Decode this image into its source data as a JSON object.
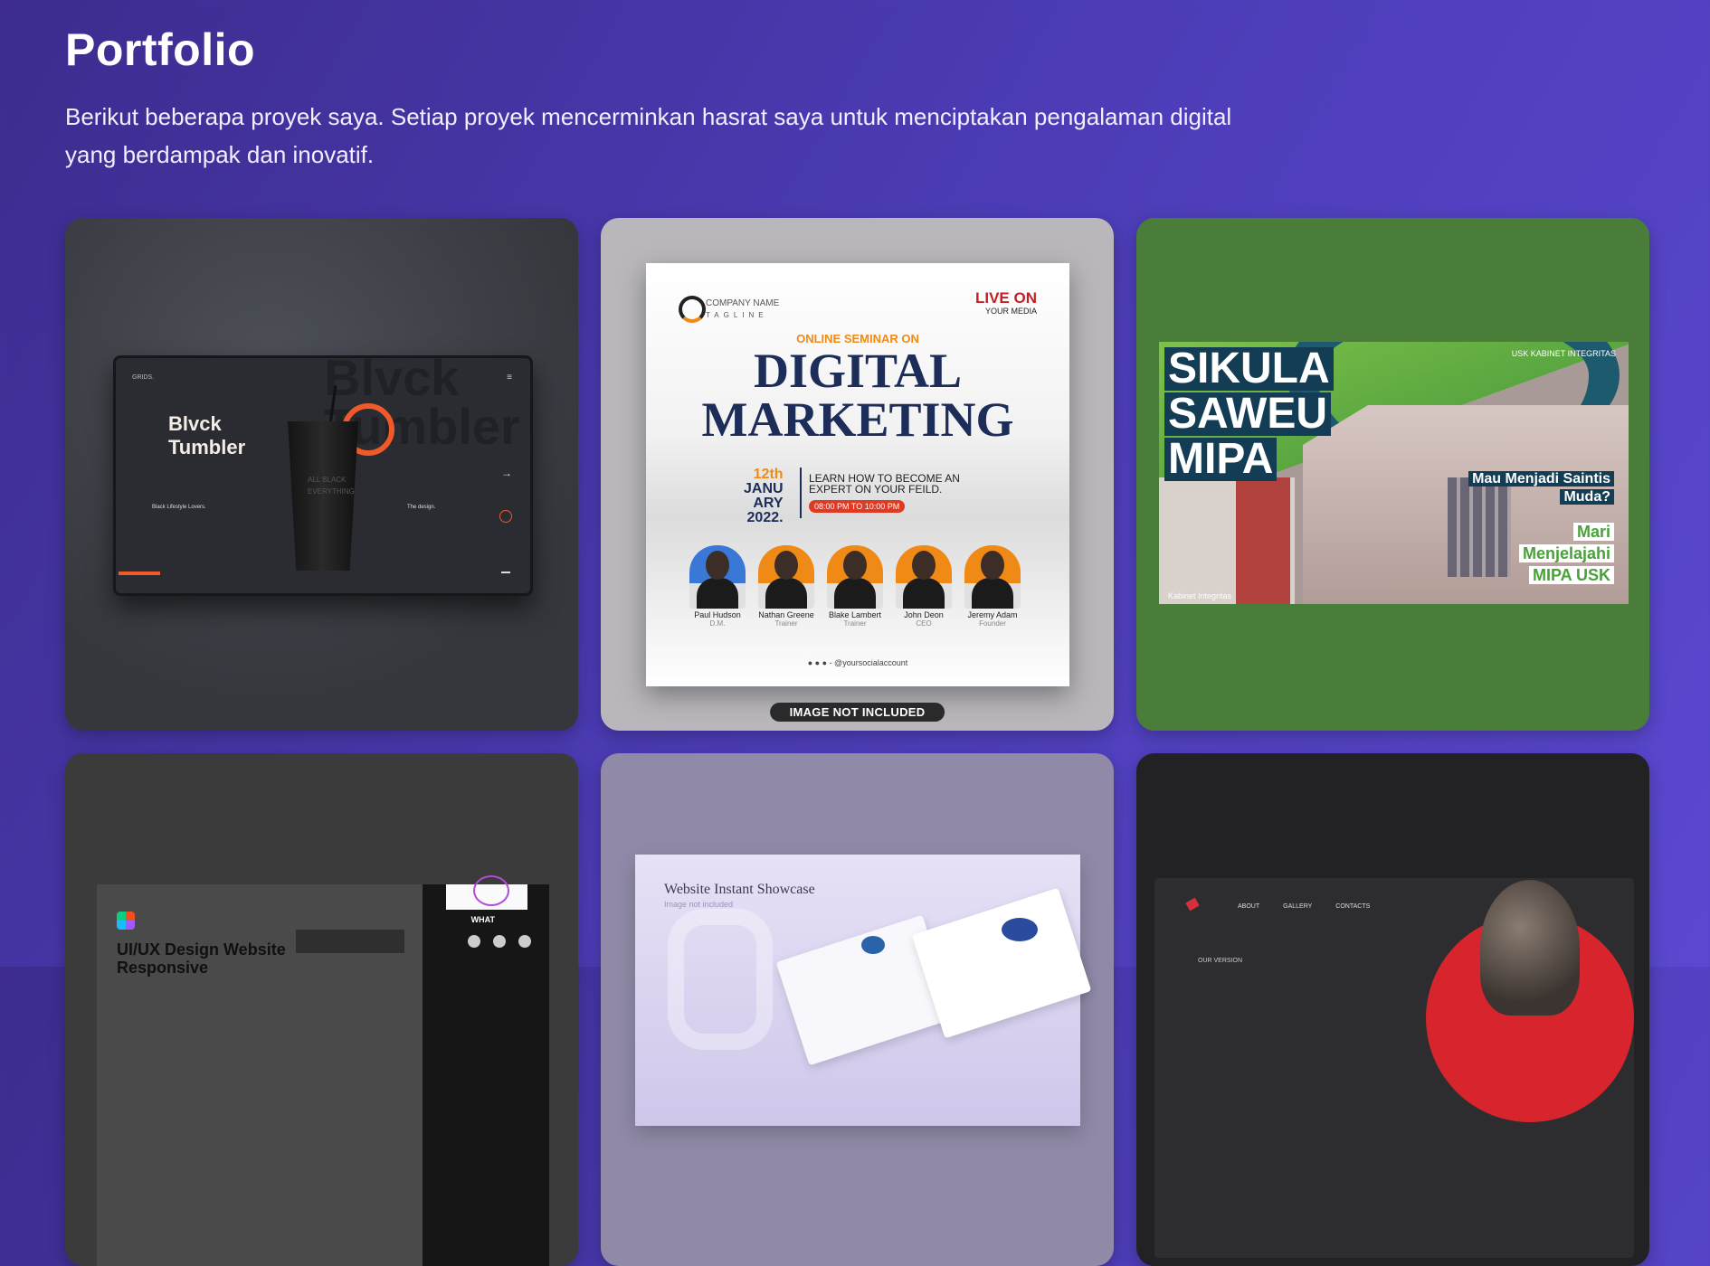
{
  "page": {
    "title": "Portfolio",
    "description": "Berikut beberapa proyek saya. Setiap proyek mencerminkan hasrat saya untuk menciptakan pengalaman digital yang berdampak dan inovatif."
  },
  "colors": {
    "background_start": "#3d2c8e",
    "background_end": "#5a48d0",
    "accent_orange": "#ee5a2a",
    "card3_green": "#4a7c3a"
  },
  "projects": [
    {
      "brand": "GRIDS.",
      "heading": "Blvck Tumbler",
      "bg_word": "Blvck Tumbler",
      "cup_text": "ALL BLACK EVERYTHING",
      "left_caption": "Black Lifestyle Lovers.",
      "right_caption": "The design."
    },
    {
      "company": "COMPANY NAME",
      "tagline": "TAGLINE",
      "live": "LIVE ON",
      "live_sub": "YOUR MEDIA",
      "online": "ONLINE SEMINAR ON",
      "big_line1": "DIGITAL",
      "big_line2": "MARKETING",
      "date_day": "12th",
      "date_month1": "JANU",
      "date_month2": "ARY",
      "date_year": "2022.",
      "learn": "LEARN HOW TO BECOME AN EXPERT ON YOUR FEILD.",
      "time": "08:00 PM TO 10:00 PM",
      "speakers": [
        {
          "name": "Paul Hudson",
          "role": "D.M."
        },
        {
          "name": "Nathan Greene",
          "role": "Trainer"
        },
        {
          "name": "Blake Lambert",
          "role": "Trainer"
        },
        {
          "name": "John Deon",
          "role": "CEO"
        },
        {
          "name": "Jeremy Adam",
          "role": "Founder"
        }
      ],
      "social": "- @yoursocialaccount",
      "badge": "IMAGE NOT INCLUDED"
    },
    {
      "line1": "SIKULA",
      "line2": "SAWEU",
      "line3": "MIPA",
      "question1": "Mau Menjadi Saintis",
      "question2": "Muda?",
      "cta1": "Mari",
      "cta2": "Menjelajahi",
      "cta3": "MIPA USK",
      "logos": "USK  KABINET INTEGRITAS",
      "footer": "Kabinet Integritas"
    },
    {
      "title": "UI/UX Design Website Responsive",
      "what": "WHAT"
    },
    {
      "title": "Website Instant Showcase",
      "subtitle": "Image not included"
    },
    {
      "nav": [
        "ABOUT",
        "GALLERY",
        "CONTACTS"
      ],
      "version": "OUR VERSION"
    }
  ]
}
